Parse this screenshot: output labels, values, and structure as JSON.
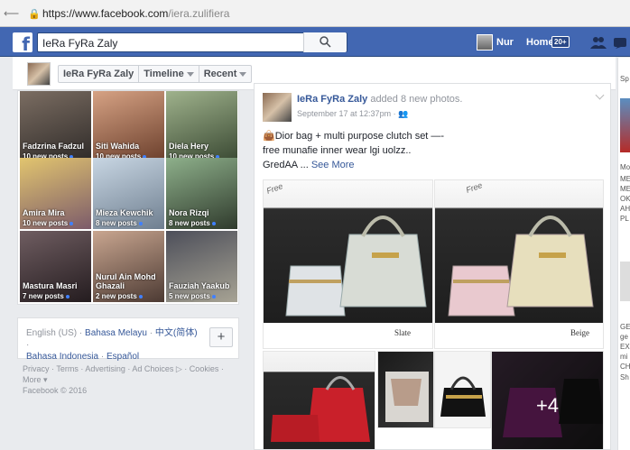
{
  "browser": {
    "url_host": "https://www.facebook.com",
    "url_path": "/iera.zulifiera"
  },
  "topnav": {
    "logo": "f",
    "search_value": "IeRa FyRa Zaly",
    "user": "Nur",
    "home": "Home",
    "home_count": "20+"
  },
  "profile_bar": {
    "name": "IeRa FyRa Zaly",
    "timeline": "Timeline",
    "recent": "Recent"
  },
  "friends": [
    {
      "name": "Fadzrina Fadzul",
      "posts": "10 new posts",
      "c1": "#7b6d62",
      "c2": "#2e2a28"
    },
    {
      "name": "Siti Wahida",
      "posts": "10 new posts",
      "c1": "#d6a284",
      "c2": "#6a3e2b"
    },
    {
      "name": "Diela Hery",
      "posts": "10 new posts",
      "c1": "#9fb28c",
      "c2": "#394832"
    },
    {
      "name": "Amira Mira",
      "posts": "10 new posts",
      "c1": "#e2c56f",
      "c2": "#7c5b6a"
    },
    {
      "name": "Mieza Kewchik",
      "posts": "8 new posts",
      "c1": "#c8d6e3",
      "c2": "#6f7f90"
    },
    {
      "name": "Nora Rizqi",
      "posts": "8 new posts",
      "c1": "#8eb08b",
      "c2": "#2f3a2c"
    },
    {
      "name": "Mastura Masri",
      "posts": "7 new posts",
      "c1": "#6f5d61",
      "c2": "#241c1f"
    },
    {
      "name": "Nurul Ain Mohd Ghazali",
      "posts": "2 new posts",
      "c1": "#c9a690",
      "c2": "#4c3a33"
    },
    {
      "name": "Fauziah Yaakub",
      "posts": "5 new posts",
      "c1": "#4d4f5a",
      "c2": "#a7a394"
    }
  ],
  "languages": {
    "current": "English (US)",
    "sep": " · ",
    "links": [
      "Bahasa Melayu",
      "中文(简体)",
      "Bahasa Indonesia",
      "Español"
    ],
    "plus": "+"
  },
  "footer": {
    "line1": "Privacy · Terms · Advertising · Ad Choices ▷ · Cookies ·",
    "line2": "More ▾",
    "line3": "Facebook © 2016"
  },
  "post": {
    "author": "IeRa FyRa Zaly",
    "action": " added 8 new photos.",
    "time": "September 17 at 12:37pm · ",
    "text1": "👜Dior bag + multi purpose clutch set —-",
    "text2": "free munafie inner wear lgi uolzz..",
    "text3": "GredAA ... ",
    "see_more": "See More",
    "photo1_label": "Slate",
    "photo1_tag": "Free",
    "photo2_label": "Beige",
    "photo2_tag": "Free",
    "more_count": "+4"
  },
  "right_column": [
    "Sp",
    "Mo",
    "ME",
    "ME",
    "OK",
    "AH",
    "PL",
    "GE",
    "ge",
    "EX",
    "mi",
    "CH",
    "Sh"
  ]
}
